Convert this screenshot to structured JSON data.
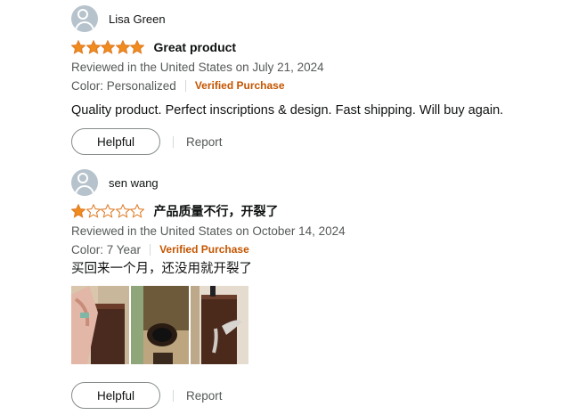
{
  "reviews": [
    {
      "reviewer": "Lisa Green",
      "rating": 5,
      "title": "Great product",
      "date_line": "Reviewed in the United States on July 21, 2024",
      "variant": "Color: Personalized",
      "verified": "Verified Purchase",
      "body": "Quality product. Perfect inscriptions & design. Fast shipping. Will buy again.",
      "helpful_label": "Helpful",
      "report_label": "Report"
    },
    {
      "reviewer": "sen wang",
      "rating": 1,
      "title": "产品质量不行，开裂了",
      "date_line": "Reviewed in the United States on October 14, 2024",
      "variant": "Color: 7 Year",
      "verified": "Verified Purchase",
      "body": "买回来一个月，还没用就开裂了",
      "helpful_label": "Helpful",
      "report_label": "Report",
      "images": [
        "review-photo-1",
        "review-photo-2",
        "review-photo-3"
      ]
    }
  ],
  "colors": {
    "star_fill": "#f08b1d",
    "star_empty": "#ffffff",
    "star_outline": "#de7921",
    "verified": "#c45500",
    "secondary_text": "#565959"
  }
}
